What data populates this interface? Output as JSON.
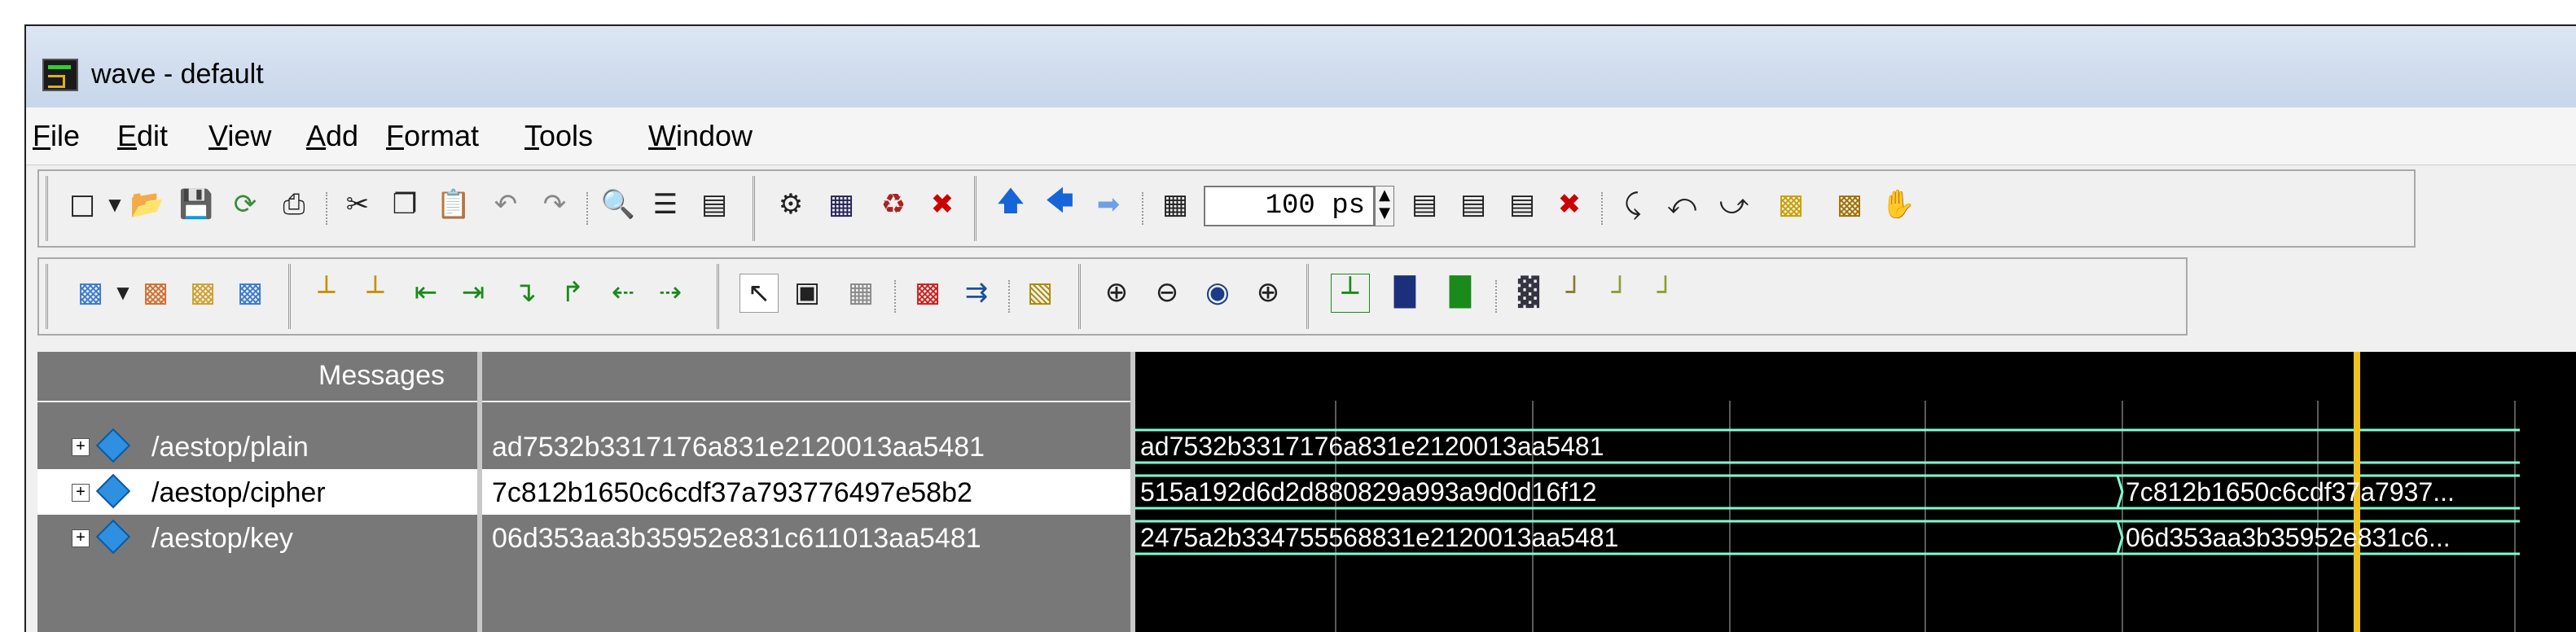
{
  "window": {
    "title": "wave - default"
  },
  "menu": [
    "File",
    "Edit",
    "View",
    "Add",
    "Format",
    "Tools",
    "Window"
  ],
  "toolbar": {
    "zoom_value": "100",
    "zoom_unit": "ps"
  },
  "messages_header": "Messages",
  "signals": [
    {
      "name": "/aestop/plain",
      "value": "ad7532b3317176a831e2120013aa5481",
      "selected": false
    },
    {
      "name": "/aestop/cipher",
      "value": "7c812b1650c6cdf37a793776497e58b2",
      "selected": true
    },
    {
      "name": "/aestop/key",
      "value": "06d353aa3b35952e831c611013aa5481",
      "selected": false
    }
  ],
  "wave_labels": [
    {
      "row": 0,
      "segments": [
        "ad7532b3317176a831e2120013aa5481"
      ]
    },
    {
      "row": 1,
      "segments": [
        "515a192d6d2d880829a993a9d0d16f12",
        "7c812b1650c6cdf37a7937..."
      ]
    },
    {
      "row": 2,
      "segments": [
        "2475a2b334755568831e2120013aa5481",
        "06d353aa3b35952e831c6..."
      ]
    }
  ],
  "colors": {
    "wave_bus": "#7fffd4",
    "cursor": "#f2c21c",
    "pane_bg": "#787878"
  },
  "icons": {
    "toolbar1": [
      "new-file-icon",
      "open-folder-icon",
      "save-icon",
      "reload-icon",
      "print-icon",
      "cut-icon",
      "copy-icon",
      "paste-icon",
      "undo-icon",
      "redo-icon",
      "find-icon",
      "hierarchy-icon",
      "group-icon",
      "compile-icon",
      "simulate-icon",
      "restart-icon",
      "break-icon",
      "step-up-icon",
      "step-back-icon",
      "step-forward-icon",
      "run-length-icon",
      "spin-icon",
      "run-icon",
      "continue-icon",
      "run-all-icon",
      "stop-icon",
      "step-icon",
      "step-over-icon",
      "step-out-icon",
      "profile-icon",
      "coverage-icon",
      "hand-icon"
    ],
    "toolbar2": [
      "add-wave-icon",
      "remove-wave-icon",
      "edit-wave-icon",
      "wave-props-icon",
      "insert-cursor-icon",
      "delete-cursor-icon",
      "prev-edge-icon",
      "next-edge-icon",
      "falling-edge-icon",
      "rising-edge-icon",
      "prev-transition-icon",
      "next-transition-icon",
      "select-icon",
      "zoom-area-icon",
      "grid-icon",
      "signal-trace-icon",
      "trace-input-icon",
      "wave-compare-icon",
      "zoom-in-icon",
      "zoom-out-icon",
      "zoom-full-icon",
      "zoom-cursor-icon",
      "cursor-line-icon",
      "bar-icon",
      "fill-icon",
      "pattern-icon",
      "step-edge-icon",
      "step-icon-2",
      "step-icon-3"
    ]
  }
}
